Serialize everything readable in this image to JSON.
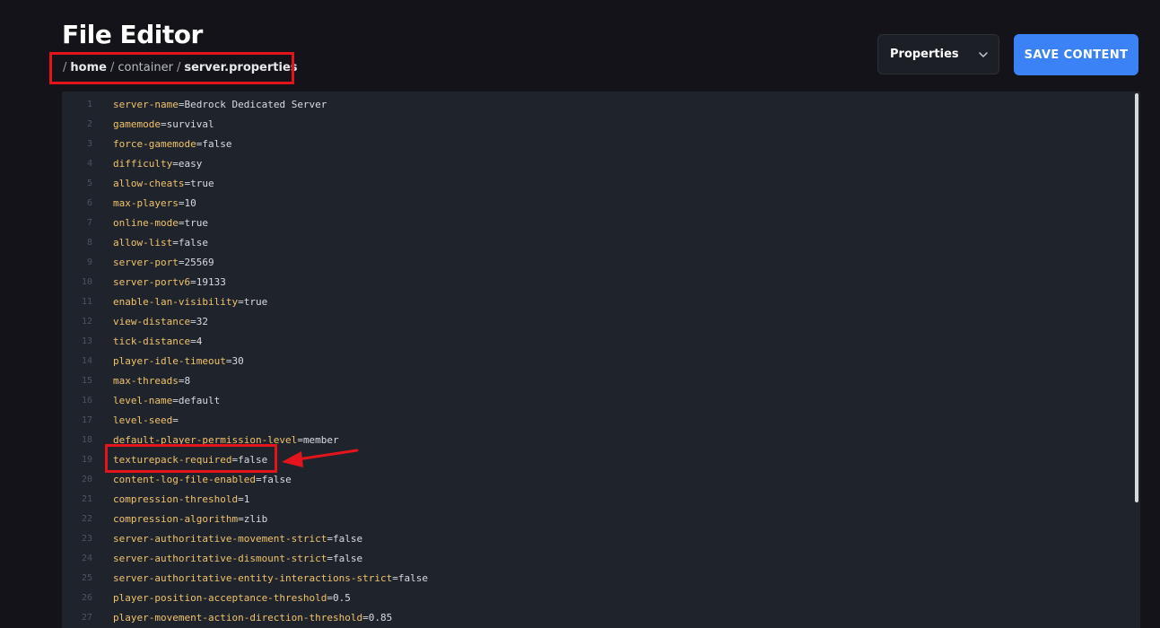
{
  "header": {
    "title": "File Editor",
    "breadcrumb": {
      "sep": "/",
      "home": "home",
      "container": "container",
      "file": "server.properties"
    }
  },
  "toolbar": {
    "language_select": {
      "value": "Properties"
    },
    "save_label": "SAVE CONTENT"
  },
  "editor": {
    "lines": [
      {
        "n": "1",
        "key": "server-name",
        "eq": "=",
        "val": "Bedrock Dedicated Server"
      },
      {
        "n": "2",
        "key": "gamemode",
        "eq": "=",
        "val": "survival"
      },
      {
        "n": "3",
        "key": "force-gamemode",
        "eq": "=",
        "val": "false"
      },
      {
        "n": "4",
        "key": "difficulty",
        "eq": "=",
        "val": "easy"
      },
      {
        "n": "5",
        "key": "allow-cheats",
        "eq": "=",
        "val": "true"
      },
      {
        "n": "6",
        "key": "max-players",
        "eq": "=",
        "val": "10"
      },
      {
        "n": "7",
        "key": "online-mode",
        "eq": "=",
        "val": "true"
      },
      {
        "n": "8",
        "key": "allow-list",
        "eq": "=",
        "val": "false"
      },
      {
        "n": "9",
        "key": "server-port",
        "eq": "=",
        "val": "25569"
      },
      {
        "n": "10",
        "key": "server-portv6",
        "eq": "=",
        "val": "19133"
      },
      {
        "n": "11",
        "key": "enable-lan-visibility",
        "eq": "=",
        "val": "true"
      },
      {
        "n": "12",
        "key": "view-distance",
        "eq": "=",
        "val": "32"
      },
      {
        "n": "13",
        "key": "tick-distance",
        "eq": "=",
        "val": "4"
      },
      {
        "n": "14",
        "key": "player-idle-timeout",
        "eq": "=",
        "val": "30"
      },
      {
        "n": "15",
        "key": "max-threads",
        "eq": "=",
        "val": "8"
      },
      {
        "n": "16",
        "key": "level-name",
        "eq": "=",
        "val": "default"
      },
      {
        "n": "17",
        "key": "level-seed",
        "eq": "=",
        "val": ""
      },
      {
        "n": "18",
        "key": "default-player-permission-level",
        "eq": "=",
        "val": "member"
      },
      {
        "n": "19",
        "key": "texturepack-required",
        "eq": "=",
        "val": "false"
      },
      {
        "n": "20",
        "key": "content-log-file-enabled",
        "eq": "=",
        "val": "false"
      },
      {
        "n": "21",
        "key": "compression-threshold",
        "eq": "=",
        "val": "1"
      },
      {
        "n": "22",
        "key": "compression-algorithm",
        "eq": "=",
        "val": "zlib"
      },
      {
        "n": "23",
        "key": "server-authoritative-movement-strict",
        "eq": "=",
        "val": "false"
      },
      {
        "n": "24",
        "key": "server-authoritative-dismount-strict",
        "eq": "=",
        "val": "false"
      },
      {
        "n": "25",
        "key": "server-authoritative-entity-interactions-strict",
        "eq": "=",
        "val": "false"
      },
      {
        "n": "26",
        "key": "player-position-acceptance-threshold",
        "eq": "=",
        "val": "0.5"
      },
      {
        "n": "27",
        "key": "player-movement-action-direction-threshold",
        "eq": "=",
        "val": "0.85"
      }
    ]
  },
  "colors": {
    "accent": "#3b82f6",
    "annotation": "#e3141c",
    "key": "#f1c36b"
  },
  "icons": {
    "select_chevron": "chevron-down-icon",
    "annotation_arrow": "arrow-left-icon"
  }
}
